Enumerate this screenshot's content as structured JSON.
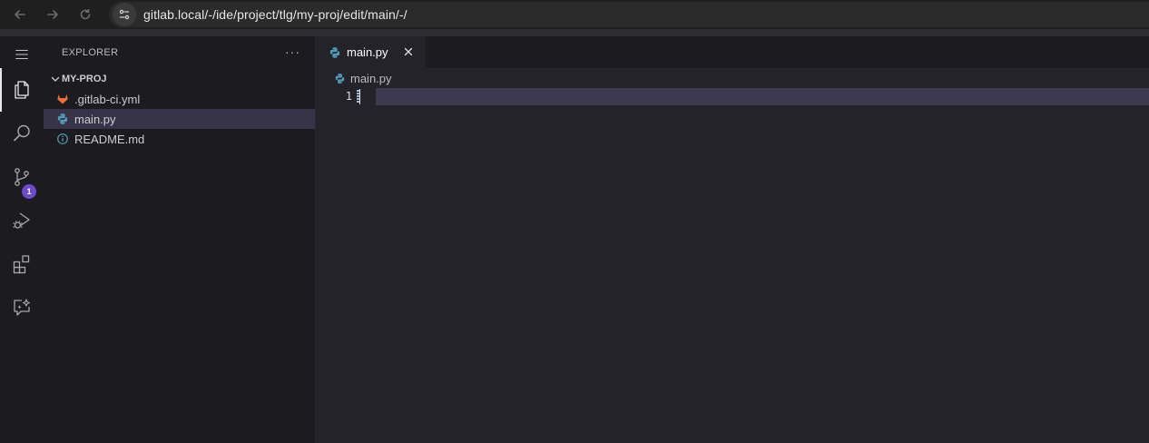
{
  "browser": {
    "url": "gitlab.local/-/ide/project/tlg/my-proj/edit/main/-/"
  },
  "activity_bar": {
    "items": [
      {
        "name": "explorer",
        "icon": "files-icon",
        "active": true
      },
      {
        "name": "search",
        "icon": "search-icon"
      },
      {
        "name": "source-control",
        "icon": "source-control-icon",
        "badge": "1"
      },
      {
        "name": "run-debug",
        "icon": "run-debug-icon"
      },
      {
        "name": "extensions",
        "icon": "extensions-icon"
      },
      {
        "name": "chat",
        "icon": "chat-sparkle-icon"
      }
    ]
  },
  "sidebar": {
    "title": "EXPLORER",
    "more": "···",
    "project": "MY-PROJ",
    "files": [
      {
        "name": ".gitlab-ci.yml",
        "icon": "gitlab-icon",
        "selected": false
      },
      {
        "name": "main.py",
        "icon": "python-icon",
        "selected": true
      },
      {
        "name": "README.md",
        "icon": "info-icon",
        "selected": false
      }
    ]
  },
  "editor": {
    "tab_label": "main.py",
    "breadcrumb": "main.py",
    "line_number": "1"
  },
  "colors": {
    "accent": "#6e49cb",
    "selection": "#37344a",
    "current_line": "#3d3950",
    "python_blue": "#519aba",
    "gitlab_orange": "#e2703a"
  }
}
